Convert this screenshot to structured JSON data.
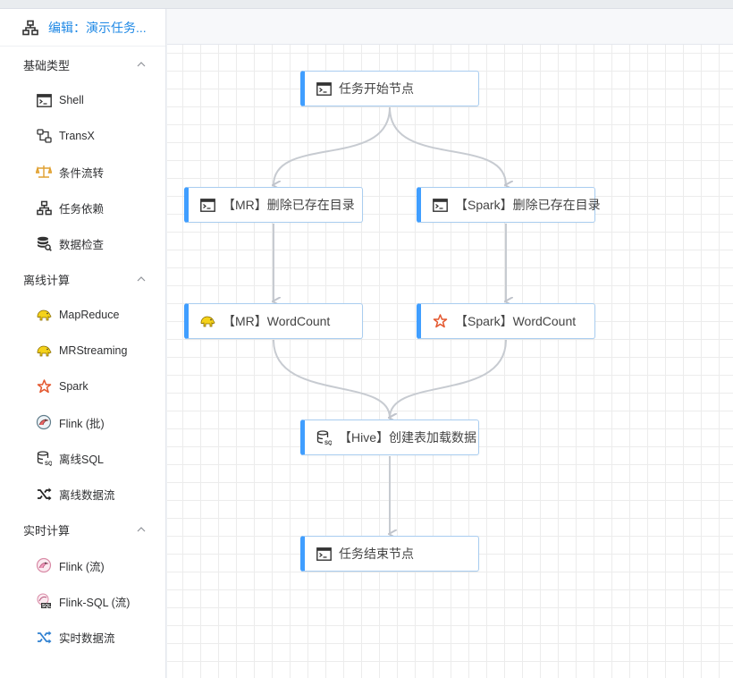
{
  "sidebar": {
    "title": "编辑：演示任务...",
    "groups": [
      {
        "label": "基础类型",
        "items": [
          {
            "label": "Shell",
            "icon": "terminal-icon"
          },
          {
            "label": "TransX",
            "icon": "transx-icon"
          },
          {
            "label": "条件流转",
            "icon": "balance-scale-icon"
          },
          {
            "label": "任务依赖",
            "icon": "sitemap-icon"
          },
          {
            "label": "数据检查",
            "icon": "database-search-icon"
          }
        ]
      },
      {
        "label": "离线计算",
        "items": [
          {
            "label": "MapReduce",
            "icon": "hadoop-elephant-icon"
          },
          {
            "label": "MRStreaming",
            "icon": "hadoop-elephant-icon"
          },
          {
            "label": "Spark",
            "icon": "spark-star-icon"
          },
          {
            "label": "Flink (批)",
            "icon": "flink-squirrel-icon"
          },
          {
            "label": "离线SQL",
            "icon": "sql-database-icon"
          },
          {
            "label": "离线数据流",
            "icon": "shuffle-icon"
          }
        ]
      },
      {
        "label": "实时计算",
        "items": [
          {
            "label": "Flink (流)",
            "icon": "flink-squirrel-icon"
          },
          {
            "label": "Flink-SQL (流)",
            "icon": "flink-sql-icon"
          },
          {
            "label": "实时数据流",
            "icon": "shuffle-icon"
          }
        ]
      }
    ]
  },
  "workflow": {
    "nodes": [
      {
        "label": "任务开始节点",
        "icon": "terminal-icon"
      },
      {
        "label": "【MR】删除已存在目录",
        "icon": "terminal-icon"
      },
      {
        "label": "【Spark】删除已存在目录",
        "icon": "terminal-icon"
      },
      {
        "label": "【MR】WordCount",
        "icon": "hadoop-elephant-icon"
      },
      {
        "label": "【Spark】WordCount",
        "icon": "spark-star-icon"
      },
      {
        "label": "【Hive】创建表加载数据",
        "icon": "sql-database-icon"
      },
      {
        "label": "任务结束节点",
        "icon": "terminal-icon"
      }
    ],
    "edges": [
      [
        "任务开始节点",
        "【MR】删除已存在目录"
      ],
      [
        "任务开始节点",
        "【Spark】删除已存在目录"
      ],
      [
        "【MR】删除已存在目录",
        "【MR】WordCount"
      ],
      [
        "【Spark】删除已存在目录",
        "【Spark】WordCount"
      ],
      [
        "【MR】WordCount",
        "【Hive】创建表加载数据"
      ],
      [
        "【Spark】WordCount",
        "【Hive】创建表加载数据"
      ],
      [
        "【Hive】创建表加载数据",
        "任务结束节点"
      ]
    ]
  },
  "colors": {
    "accent": "#409eff",
    "title": "#1e88e5",
    "edge": "#c0c4cc"
  }
}
